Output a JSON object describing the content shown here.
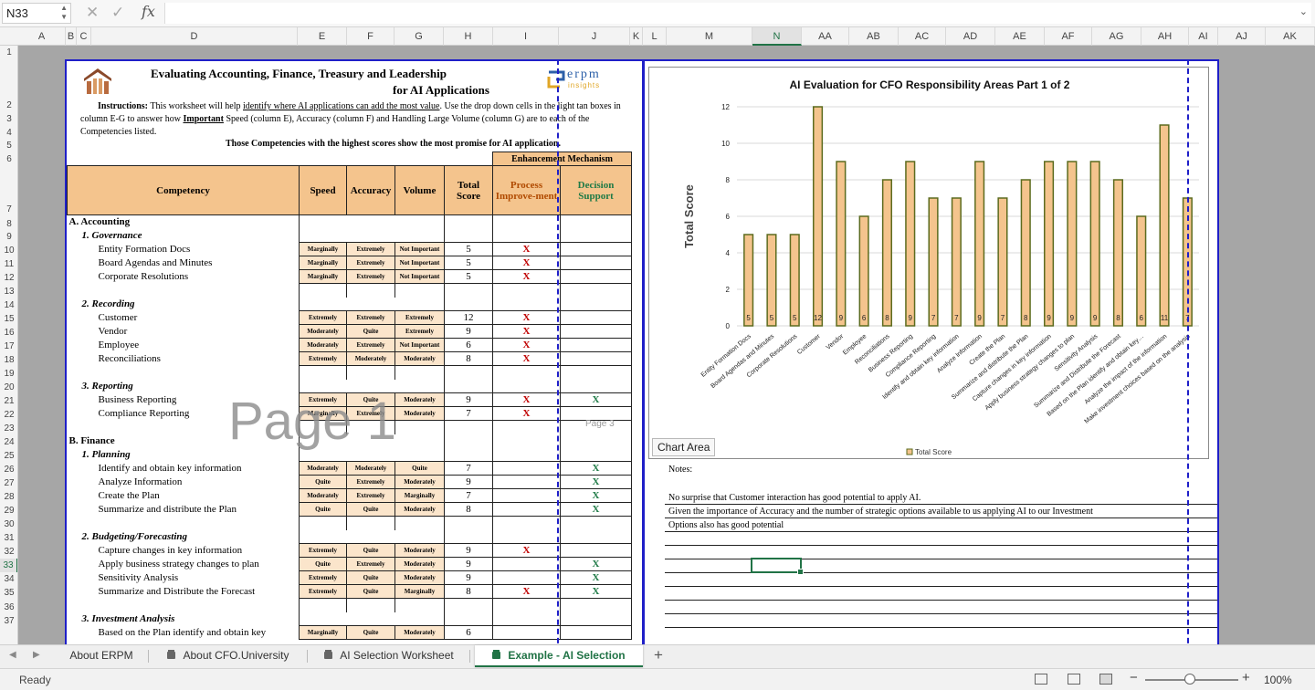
{
  "formula_bar": {
    "name_box": "N33",
    "fx": "fx",
    "formula": ""
  },
  "columns": [
    "A",
    "B",
    "C",
    "D",
    "E",
    "F",
    "G",
    "H",
    "I",
    "J",
    "K",
    "L",
    "M",
    "N",
    "AA",
    "AB",
    "AC",
    "AD",
    "AE",
    "AF",
    "AG",
    "AH",
    "AI",
    "AJ",
    "AK"
  ],
  "rows": [
    "1",
    "2",
    "3",
    "4",
    "5",
    "6",
    "7",
    "8",
    "9",
    "10",
    "11",
    "12",
    "13",
    "14",
    "15",
    "16",
    "17",
    "18",
    "19",
    "20",
    "21",
    "22",
    "23",
    "24",
    "25",
    "26",
    "27",
    "28",
    "29",
    "30",
    "31",
    "32",
    "33",
    "34",
    "35",
    "36",
    "37"
  ],
  "active_cell": {
    "column": "N",
    "row": "33"
  },
  "sheet": {
    "title_line1": "Evaluating Accounting, Finance,  Treasury and Leadership",
    "title_line2": "for AI Applications",
    "instructions_label": "Instructions:",
    "instructions_pre": "  This worksheet will help ",
    "instructions_link": "identify where AI applications can add the most value",
    "instructions_mid": ".   Use the drop down cells in the light tan boxes in column E-G to answer how ",
    "instructions_important": "Important",
    "instructions_post": " Speed (column E), Accuracy (column F) and Handling Large Volume (column G) are to each of the Competencies listed.",
    "instructions_tail": "Those Competencies with the highest scores show the most promise for AI application.",
    "logo_text": "erpm",
    "logo_sub": "insights",
    "headers": {
      "competency": "Competency",
      "speed": "Speed",
      "accuracy": "Accuracy",
      "volume": "Volume",
      "total": "Total Score",
      "mechanism": "Enhancement Mechanism",
      "process": "Process Improve-ment",
      "decision": "Decision Support"
    },
    "page1_watermark": "Page 1",
    "page3_watermark": "Page 3",
    "sections": [
      {
        "title": "A.   Accounting",
        "groups": [
          {
            "title": "1.  Governance",
            "items": [
              {
                "name": "Entity Formation Docs",
                "speed": "Marginally",
                "accuracy": "Extremely",
                "volume": "Not Important",
                "total": "5",
                "process": "X",
                "decision": ""
              },
              {
                "name": "Board Agendas and Minutes",
                "speed": "Marginally",
                "accuracy": "Extremely",
                "volume": "Not Important",
                "total": "5",
                "process": "X",
                "decision": ""
              },
              {
                "name": "Corporate Resolutions",
                "speed": "Marginally",
                "accuracy": "Extremely",
                "volume": "Not Important",
                "total": "5",
                "process": "X",
                "decision": ""
              }
            ]
          },
          {
            "title": "2.  Recording",
            "items": [
              {
                "name": "Customer",
                "speed": "Extremely",
                "accuracy": "Extremely",
                "volume": "Extremely",
                "total": "12",
                "process": "X",
                "decision": ""
              },
              {
                "name": "Vendor",
                "speed": "Moderately",
                "accuracy": "Quite",
                "volume": "Extremely",
                "total": "9",
                "process": "X",
                "decision": ""
              },
              {
                "name": "Employee",
                "speed": "Moderately",
                "accuracy": "Extremely",
                "volume": "Not Important",
                "total": "6",
                "process": "X",
                "decision": ""
              },
              {
                "name": "Reconciliations",
                "speed": "Extremely",
                "accuracy": "Moderately",
                "volume": "Moderately",
                "total": "8",
                "process": "X",
                "decision": ""
              }
            ]
          },
          {
            "title": "3.  Reporting",
            "items": [
              {
                "name": "Business Reporting",
                "speed": "Extremely",
                "accuracy": "Quite",
                "volume": "Moderately",
                "total": "9",
                "process": "X",
                "decision": "X"
              },
              {
                "name": "Compliance Reporting",
                "speed": "Marginally",
                "accuracy": "Extremely",
                "volume": "Moderately",
                "total": "7",
                "process": "X",
                "decision": ""
              }
            ]
          }
        ]
      },
      {
        "title": "B.  Finance",
        "groups": [
          {
            "title": "1.  Planning",
            "items": [
              {
                "name": "Identify and obtain key information",
                "speed": "Moderately",
                "accuracy": "Moderately",
                "volume": "Quite",
                "total": "7",
                "process": "",
                "decision": "X"
              },
              {
                "name": "Analyze Information",
                "speed": "Quite",
                "accuracy": "Extremely",
                "volume": "Moderately",
                "total": "9",
                "process": "",
                "decision": "X"
              },
              {
                "name": "Create the Plan",
                "speed": "Moderately",
                "accuracy": "Extremely",
                "volume": "Marginally",
                "total": "7",
                "process": "",
                "decision": "X"
              },
              {
                "name": "Summarize and distribute the Plan",
                "speed": "Quite",
                "accuracy": "Quite",
                "volume": "Moderately",
                "total": "8",
                "process": "",
                "decision": "X"
              }
            ]
          },
          {
            "title": "2.  Budgeting/Forecasting",
            "items": [
              {
                "name": "Capture changes in key information",
                "speed": "Extremely",
                "accuracy": "Quite",
                "volume": "Moderately",
                "total": "9",
                "process": "X",
                "decision": ""
              },
              {
                "name": "Apply business strategy changes to plan",
                "speed": "Quite",
                "accuracy": "Extremely",
                "volume": "Moderately",
                "total": "9",
                "process": "",
                "decision": "X"
              },
              {
                "name": "Sensitivity Analysis",
                "speed": "Extremely",
                "accuracy": "Quite",
                "volume": "Moderately",
                "total": "9",
                "process": "",
                "decision": "X"
              },
              {
                "name": "Summarize and Distribute the Forecast",
                "speed": "Extremely",
                "accuracy": "Quite",
                "volume": "Marginally",
                "total": "8",
                "process": "X",
                "decision": "X"
              }
            ]
          },
          {
            "title": "3.  Investment Analysis",
            "items": [
              {
                "name": "Based on the Plan identify and obtain key",
                "speed": "Marginally",
                "accuracy": "Quite",
                "volume": "Moderately",
                "total": "6",
                "process": "",
                "decision": ""
              }
            ]
          }
        ]
      }
    ]
  },
  "chart_tooltip": "Chart Area",
  "notes": {
    "label": "Notes:",
    "lines": [
      "No surprise that Customer interaction has good potential to apply AI.",
      "Given the importance of Accuracy and the number of strategic options available to us applying AI to our Investment",
      "Options also has good potential"
    ]
  },
  "chart_data": {
    "type": "bar",
    "title": "AI Evaluation for CFO Responsibility Areas Part 1 of 2",
    "ylabel": "Total Score",
    "xlabel": "",
    "ylim": [
      0,
      12
    ],
    "yticks": [
      "0",
      "2",
      "4",
      "6",
      "8",
      "10",
      "12"
    ],
    "grid": true,
    "legend": "bottom",
    "legend_label": "Total Score",
    "bar_color": "#f4c48d",
    "bar_edge": "#5c6b1e",
    "categories": [
      "Entity Formation Docs",
      "Board Agendas and Minutes",
      "Corporate Resolutions",
      "Customer",
      "Vendor",
      "Employee",
      "Reconciliations",
      "Business Reporting",
      "Compliance Reporting",
      "Identify and obtain key information",
      "Analyze Information",
      "Create the Plan",
      "Summarize and distribute the Plan",
      "Capture changes in key information",
      "Apply business strategy changes to plan",
      "Sensitivity Analysis",
      "Summarize and Distribute the Forecast",
      "Based on the Plan identify and obtain key…",
      "Analyze the impact of the information",
      "Make investment choices based on the analysis"
    ],
    "series": [
      {
        "name": "Total Score",
        "values": [
          5,
          5,
          5,
          12,
          9,
          6,
          8,
          9,
          7,
          7,
          9,
          7,
          8,
          9,
          9,
          9,
          8,
          6,
          11,
          7
        ]
      }
    ]
  },
  "tabs": [
    {
      "label": "About ERPM",
      "locked": false,
      "active": false
    },
    {
      "label": "About CFO.University",
      "locked": true,
      "active": false
    },
    {
      "label": "AI Selection Worksheet",
      "locked": true,
      "active": false
    },
    {
      "label": "Example - AI Selection",
      "locked": true,
      "active": true
    }
  ],
  "status": {
    "ready": "Ready",
    "zoom": "100%"
  },
  "colors": {
    "accent": "#217346",
    "page_border": "#1f1fc8",
    "header_fill": "#f4c48d",
    "input_fill": "#fbe5cb"
  },
  "icons": [
    "cancel-icon",
    "confirm-icon",
    "function-icon",
    "lock-icon",
    "add-sheet-icon",
    "normal-view-icon",
    "page-layout-icon",
    "page-break-icon"
  ]
}
